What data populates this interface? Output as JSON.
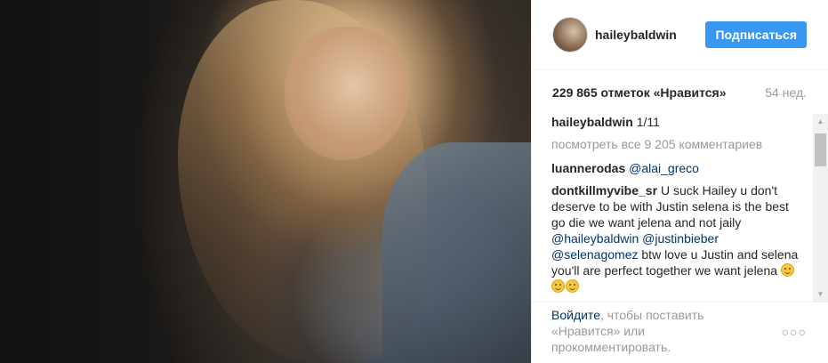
{
  "post": {
    "author": "haileybaldwin",
    "follow_label": "Подписаться",
    "likes": "229 865 отметок «Нравится»",
    "time": "54 нед.",
    "caption_author": "haileybaldwin",
    "caption_text": " 1/11",
    "view_all": "посмотреть все 9 205 комментариев"
  },
  "comments": [
    {
      "author": "luannerodas",
      "parts": [
        {
          "type": "mention",
          "text": "@alai_greco"
        }
      ]
    },
    {
      "author": "dontkillmyvibe_sr",
      "text_lead": "U suck Hailey u don't deserve to be with Justin selena is the best go die we want jelena and not jaily",
      "mention1": "@haileybaldwin",
      "mention2": "@justinbieber",
      "mention3": "@selenagomez",
      "text_tail": "btw love u Justin and selena you'll are perfect together we want jelena"
    }
  ],
  "footer": {
    "login_link": "Войдите",
    "text1": ", чтобы поставить",
    "text2": "«Нравится» или",
    "text3": "прокомментировать."
  },
  "icons": {
    "more": "more-options-icon",
    "scroll_up": "scroll-up-arrow-icon",
    "scroll_down": "scroll-down-arrow-icon"
  },
  "colors": {
    "follow_button": "#3897f0",
    "link": "#003569",
    "muted": "#999999"
  }
}
